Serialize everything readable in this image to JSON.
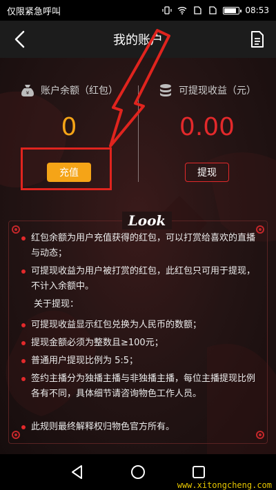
{
  "status_bar": {
    "carrier": "仅限紧急呼叫",
    "time": "08:53",
    "battery_level": 0.85
  },
  "nav": {
    "title": "我的账户"
  },
  "balance": {
    "label": "账户余额（红包）",
    "value": "0",
    "button": "充值"
  },
  "earnings": {
    "label": "可提现收益（元）",
    "value": "0.00",
    "button": "提现"
  },
  "logo_text": "Look",
  "rules": [
    "红包余额为用户充值获得的红包，可以打赏给喜欢的直播与动态；",
    "可提现收益为用户被打赏的红包，此红包只可用于提现，不计入余额中。",
    "可提现收益显示红包兑换为人民币的数额；",
    "提现金额必须为整数且≥100元；",
    "普通用户提现比例为 5:5；",
    "签约主播分为独播主播与非独播主播，每位主播提现比例各有不同，具体细节请咨询物色工作人员。",
    "此规则最终解释权归物色官方所有。"
  ],
  "withdraw_heading": "关于提现：",
  "watermark": "www.xitongcheng.com",
  "colors": {
    "accent_orange": "#f5a417",
    "accent_red": "#e3292b",
    "annotation_red": "#e0241e"
  }
}
